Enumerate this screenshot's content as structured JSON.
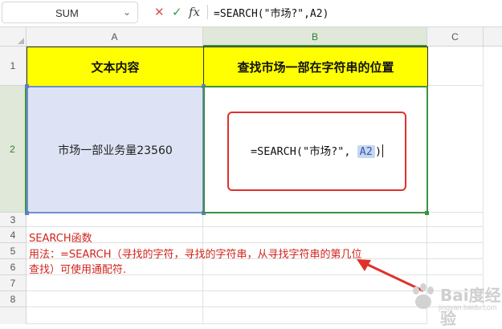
{
  "formula_bar": {
    "name_box": "SUM",
    "cancel_icon": "x-icon",
    "confirm_icon": "check-icon",
    "fx_label": "fx",
    "formula_text": "=SEARCH(\"市场?\",A2)"
  },
  "columns": [
    "A",
    "B",
    "C"
  ],
  "rows": [
    "1",
    "2",
    "3",
    "4",
    "5",
    "6",
    "7",
    "8"
  ],
  "cells": {
    "A1": "文本内容",
    "B1": "查找市场一部在字符串的位置",
    "A2": "市场一部业务量23560",
    "B2_formula_prefix": "=SEARCH(\"市场?\", ",
    "B2_formula_ref": "A2",
    "B2_formula_suffix": ")"
  },
  "notes": {
    "line1": "SEARCH函数",
    "line2": "用法：=SEARCH（寻找的字符，寻找的字符串，从寻找字符串的第几位",
    "line3": "查找）可使用通配符."
  },
  "watermark": {
    "text": "Bai度经验",
    "url_text": "jingyan.baidu.com"
  },
  "colors": {
    "header_fill": "#ffff00",
    "a2_fill": "#dde3f4",
    "selection_green": "#3d9140",
    "annotation_red": "#e0302a",
    "note_red": "#d0241c"
  }
}
